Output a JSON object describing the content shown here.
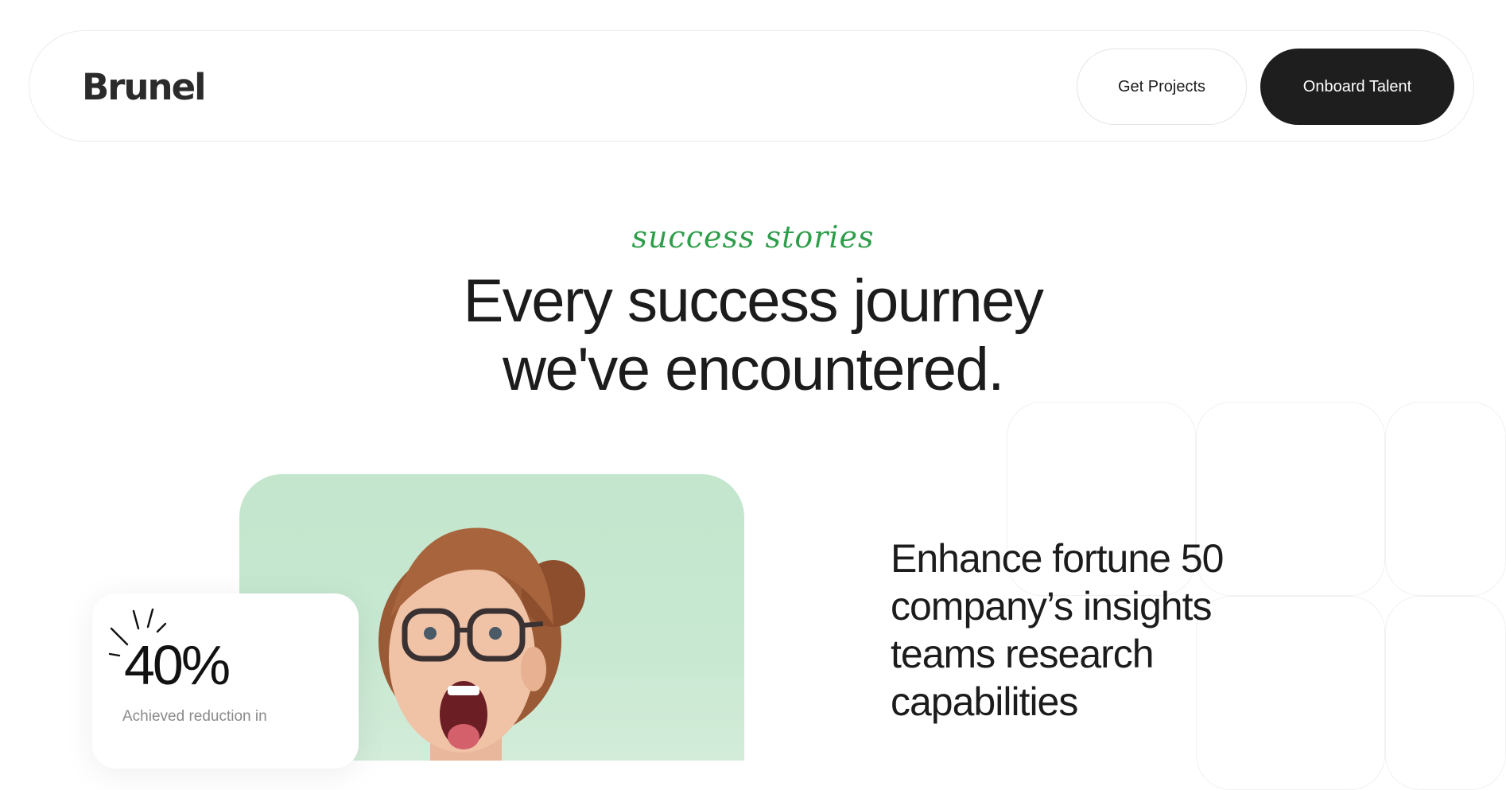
{
  "header": {
    "logo": "Brunel",
    "get_projects_label": "Get Projects",
    "onboard_talent_label": "Onboard Talent"
  },
  "hero": {
    "kicker": "success stories",
    "headline_line1": "Every success journey",
    "headline_line2": "we've encountered."
  },
  "story": {
    "title": "Enhance fortune 50 company’s insights teams research capabilities",
    "stat_value": "40%",
    "stat_description": "Achieved reduction in"
  },
  "colors": {
    "accent_green": "#2e9e4a",
    "dark_button": "#1e1e1e",
    "photo_background": "#c3e6cd"
  }
}
